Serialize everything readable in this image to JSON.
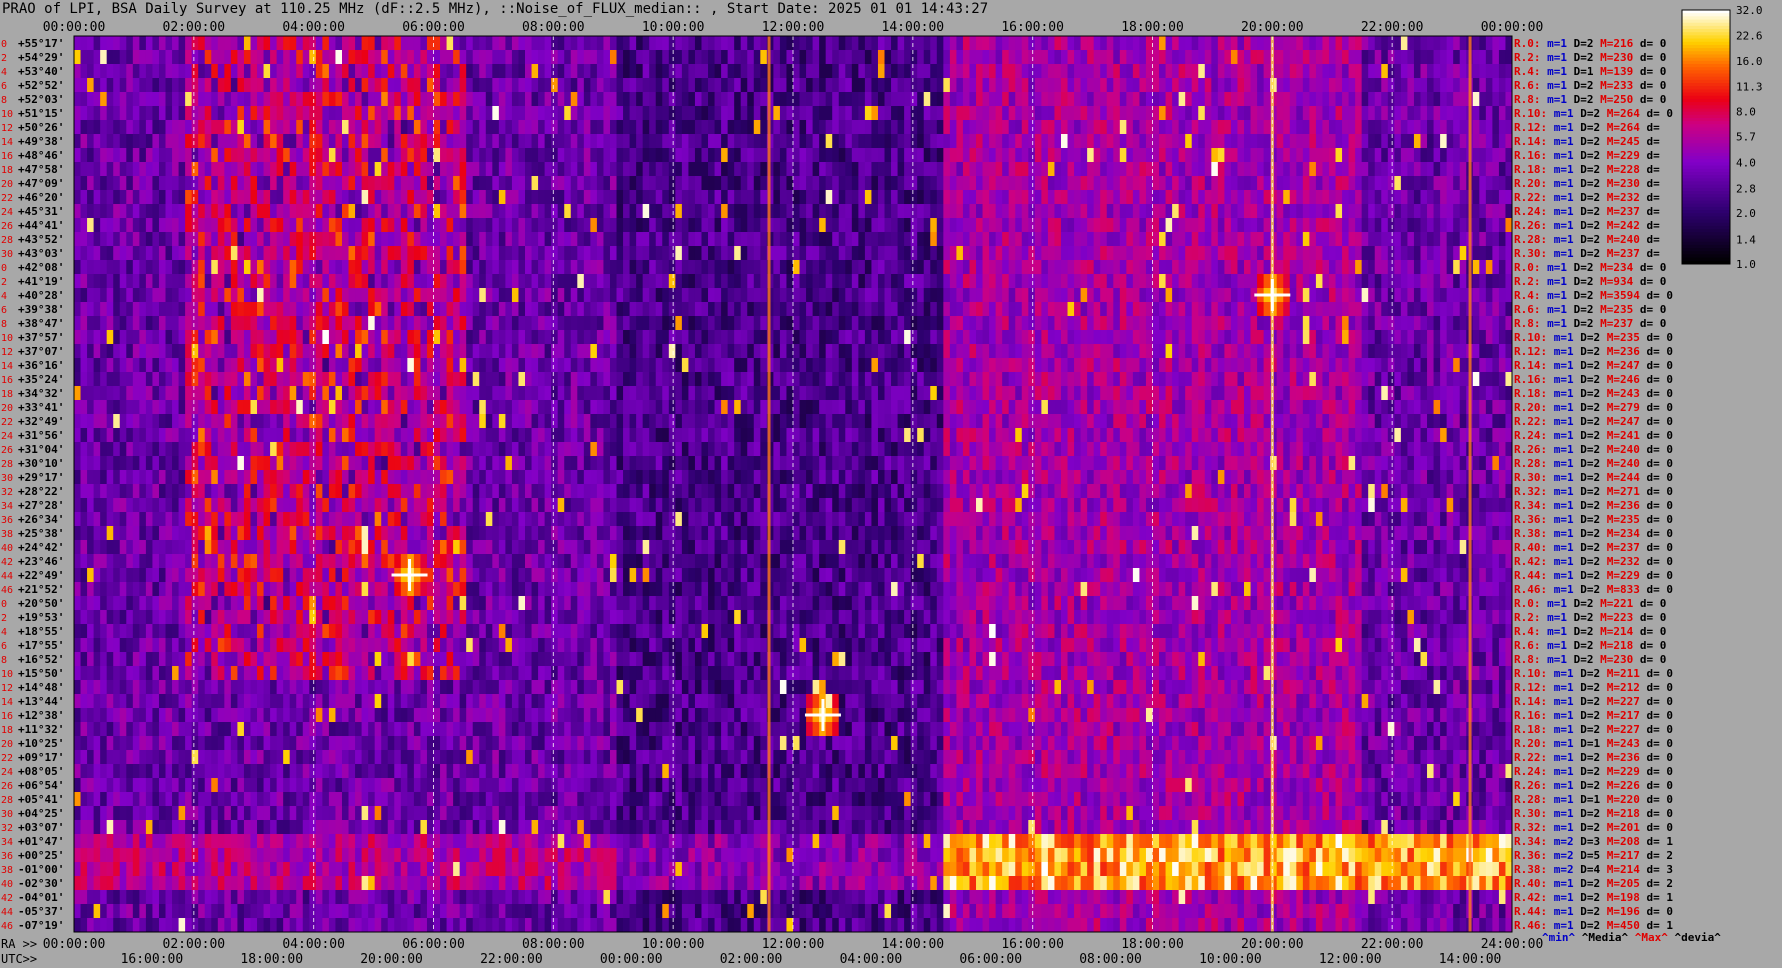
{
  "title": "PRAO of LPI, BSA Daily Survey at 110.25 MHz (dF::2.5 MHz), ::Noise_of_FLUX_median:: , Start Date: 2025 01 01 14:43:27",
  "chart_data": {
    "type": "heatmap",
    "ra_label": "RA >>",
    "utc_label": "UTC>>",
    "top_ticks": [
      "00:00:00",
      "02:00:00",
      "04:00:00",
      "06:00:00",
      "08:00:00",
      "10:00:00",
      "12:00:00",
      "14:00:00",
      "16:00:00",
      "18:00:00",
      "20:00:00",
      "22:00:00",
      "00:00:00"
    ],
    "ra_ticks": [
      "00:00:00",
      "02:00:00",
      "04:00:00",
      "06:00:00",
      "08:00:00",
      "10:00:00",
      "12:00:00",
      "14:00:00",
      "16:00:00",
      "18:00:00",
      "20:00:00",
      "22:00:00",
      "24:00:00"
    ],
    "utc_ticks": [
      "16:00:00",
      "18:00:00",
      "20:00:00",
      "22:00:00",
      "00:00:00",
      "02:00:00",
      "04:00:00",
      "06:00:00",
      "08:00:00",
      "10:00:00",
      "12:00:00",
      "14:00:00"
    ],
    "declinations": [
      "+55°17'",
      "+54°29'",
      "+53°40'",
      "+52°52'",
      "+52°03'",
      "+51°15'",
      "+50°26'",
      "+49°38'",
      "+48°46'",
      "+47°58'",
      "+47°09'",
      "+46°20'",
      "+45°31'",
      "+44°41'",
      "+43°52'",
      "+43°03'",
      "+42°08'",
      "+41°19'",
      "+40°28'",
      "+39°38'",
      "+38°47'",
      "+37°57'",
      "+37°07'",
      "+36°16'",
      "+35°24'",
      "+34°32'",
      "+33°41'",
      "+32°49'",
      "+31°56'",
      "+31°04'",
      "+30°10'",
      "+29°17'",
      "+28°22'",
      "+27°28'",
      "+26°34'",
      "+25°38'",
      "+24°42'",
      "+23°46'",
      "+22°49'",
      "+21°52'",
      "+20°50'",
      "+19°53'",
      "+18°55'",
      "+17°55'",
      "+16°52'",
      "+15°50'",
      "+14°48'",
      "+13°44'",
      "+12°38'",
      "+11°32'",
      "+10°25'",
      "+09°17'",
      "+08°05'",
      "+06°54'",
      "+05°41'",
      "+04°25'",
      "+03°07'",
      "+01°47'",
      "+00°25'",
      "-01°00'",
      "-02°30'",
      "-04°01'",
      "-05°37'",
      "-07°19'"
    ],
    "row_index_labels": [
      "0",
      "2",
      "4",
      "6",
      "8",
      "10",
      "12",
      "14",
      "16",
      "18",
      "20",
      "22",
      "24",
      "26",
      "28",
      "30",
      "0",
      "2",
      "4",
      "6",
      "8",
      "10",
      "12",
      "14",
      "16",
      "18",
      "20",
      "22",
      "24",
      "26",
      "28",
      "30",
      "32",
      "34",
      "36",
      "38",
      "40",
      "42",
      "44",
      "46",
      "0",
      "2",
      "4",
      "6",
      "8",
      "10",
      "12",
      "14",
      "16",
      "18",
      "20",
      "22",
      "24",
      "26",
      "28",
      "30",
      "32",
      "34",
      "36",
      "38",
      "40",
      "42",
      "44",
      "46"
    ],
    "stats": [
      {
        "r": "R.0:",
        "m": 1,
        "D": 2,
        "M": 216,
        "d": "0"
      },
      {
        "r": "R.2:",
        "m": 1,
        "D": 2,
        "M": 230,
        "d": "0"
      },
      {
        "r": "R.4:",
        "m": 1,
        "D": 1,
        "M": 139,
        "d": "0"
      },
      {
        "r": "R.6:",
        "m": 1,
        "D": 2,
        "M": 233,
        "d": "0"
      },
      {
        "r": "R.8:",
        "m": 1,
        "D": 2,
        "M": 250,
        "d": "0"
      },
      {
        "r": "R.10:",
        "m": 1,
        "D": 2,
        "M": 264,
        "d": "0"
      },
      {
        "r": "R.12:",
        "m": 1,
        "D": 2,
        "M": 264,
        "d": ""
      },
      {
        "r": "R.14:",
        "m": 1,
        "D": 2,
        "M": 245,
        "d": ""
      },
      {
        "r": "R.16:",
        "m": 1,
        "D": 2,
        "M": 229,
        "d": ""
      },
      {
        "r": "R.18:",
        "m": 1,
        "D": 2,
        "M": 228,
        "d": ""
      },
      {
        "r": "R.20:",
        "m": 1,
        "D": 2,
        "M": 230,
        "d": ""
      },
      {
        "r": "R.22:",
        "m": 1,
        "D": 2,
        "M": 232,
        "d": ""
      },
      {
        "r": "R.24:",
        "m": 1,
        "D": 2,
        "M": 237,
        "d": ""
      },
      {
        "r": "R.26:",
        "m": 1,
        "D": 2,
        "M": 242,
        "d": ""
      },
      {
        "r": "R.28:",
        "m": 1,
        "D": 2,
        "M": 240,
        "d": ""
      },
      {
        "r": "R.30:",
        "m": 1,
        "D": 2,
        "M": 237,
        "d": ""
      },
      {
        "r": "R.0:",
        "m": 1,
        "D": 2,
        "M": 234,
        "d": "0"
      },
      {
        "r": "R.2:",
        "m": 1,
        "D": 2,
        "M": 934,
        "d": "0"
      },
      {
        "r": "R.4:",
        "m": 1,
        "D": 2,
        "M": 3594,
        "d": "0"
      },
      {
        "r": "R.6:",
        "m": 1,
        "D": 2,
        "M": 235,
        "d": "0"
      },
      {
        "r": "R.8:",
        "m": 1,
        "D": 2,
        "M": 237,
        "d": "0"
      },
      {
        "r": "R.10:",
        "m": 1,
        "D": 2,
        "M": 235,
        "d": "0"
      },
      {
        "r": "R.12:",
        "m": 1,
        "D": 2,
        "M": 236,
        "d": "0"
      },
      {
        "r": "R.14:",
        "m": 1,
        "D": 2,
        "M": 247,
        "d": "0"
      },
      {
        "r": "R.16:",
        "m": 1,
        "D": 2,
        "M": 246,
        "d": "0"
      },
      {
        "r": "R.18:",
        "m": 1,
        "D": 2,
        "M": 243,
        "d": "0"
      },
      {
        "r": "R.20:",
        "m": 1,
        "D": 2,
        "M": 279,
        "d": "0"
      },
      {
        "r": "R.22:",
        "m": 1,
        "D": 2,
        "M": 247,
        "d": "0"
      },
      {
        "r": "R.24:",
        "m": 1,
        "D": 2,
        "M": 241,
        "d": "0"
      },
      {
        "r": "R.26:",
        "m": 1,
        "D": 2,
        "M": 240,
        "d": "0"
      },
      {
        "r": "R.28:",
        "m": 1,
        "D": 2,
        "M": 240,
        "d": "0"
      },
      {
        "r": "R.30:",
        "m": 1,
        "D": 2,
        "M": 244,
        "d": "0"
      },
      {
        "r": "R.32:",
        "m": 1,
        "D": 2,
        "M": 271,
        "d": "0"
      },
      {
        "r": "R.34:",
        "m": 1,
        "D": 2,
        "M": 236,
        "d": "0"
      },
      {
        "r": "R.36:",
        "m": 1,
        "D": 2,
        "M": 235,
        "d": "0"
      },
      {
        "r": "R.38:",
        "m": 1,
        "D": 2,
        "M": 234,
        "d": "0"
      },
      {
        "r": "R.40:",
        "m": 1,
        "D": 2,
        "M": 237,
        "d": "0"
      },
      {
        "r": "R.42:",
        "m": 1,
        "D": 2,
        "M": 232,
        "d": "0"
      },
      {
        "r": "R.44:",
        "m": 1,
        "D": 2,
        "M": 229,
        "d": "0"
      },
      {
        "r": "R.46:",
        "m": 1,
        "D": 2,
        "M": 833,
        "d": "0"
      },
      {
        "r": "R.0:",
        "m": 1,
        "D": 2,
        "M": 221,
        "d": "0"
      },
      {
        "r": "R.2:",
        "m": 1,
        "D": 2,
        "M": 223,
        "d": "0"
      },
      {
        "r": "R.4:",
        "m": 1,
        "D": 2,
        "M": 214,
        "d": "0"
      },
      {
        "r": "R.6:",
        "m": 1,
        "D": 2,
        "M": 218,
        "d": "0"
      },
      {
        "r": "R.8:",
        "m": 1,
        "D": 2,
        "M": 230,
        "d": "0"
      },
      {
        "r": "R.10:",
        "m": 1,
        "D": 2,
        "M": 211,
        "d": "0"
      },
      {
        "r": "R.12:",
        "m": 1,
        "D": 2,
        "M": 212,
        "d": "0"
      },
      {
        "r": "R.14:",
        "m": 1,
        "D": 2,
        "M": 227,
        "d": "0"
      },
      {
        "r": "R.16:",
        "m": 1,
        "D": 2,
        "M": 217,
        "d": "0"
      },
      {
        "r": "R.18:",
        "m": 1,
        "D": 2,
        "M": 227,
        "d": "0"
      },
      {
        "r": "R.20:",
        "m": 1,
        "D": 1,
        "M": 243,
        "d": "0"
      },
      {
        "r": "R.22:",
        "m": 1,
        "D": 2,
        "M": 236,
        "d": "0"
      },
      {
        "r": "R.24:",
        "m": 1,
        "D": 2,
        "M": 229,
        "d": "0"
      },
      {
        "r": "R.26:",
        "m": 1,
        "D": 2,
        "M": 226,
        "d": "0"
      },
      {
        "r": "R.28:",
        "m": 1,
        "D": 1,
        "M": 220,
        "d": "0"
      },
      {
        "r": "R.30:",
        "m": 1,
        "D": 2,
        "M": 218,
        "d": "0"
      },
      {
        "r": "R.32:",
        "m": 1,
        "D": 2,
        "M": 201,
        "d": "0"
      },
      {
        "r": "R.34:",
        "m": 2,
        "D": 3,
        "M": 208,
        "d": "1"
      },
      {
        "r": "R.36:",
        "m": 2,
        "D": 5,
        "M": 217,
        "d": "2"
      },
      {
        "r": "R.38:",
        "m": 2,
        "D": 4,
        "M": 214,
        "d": "3"
      },
      {
        "r": "R.40:",
        "m": 1,
        "D": 2,
        "M": 205,
        "d": "2"
      },
      {
        "r": "R.42:",
        "m": 1,
        "D": 2,
        "M": 198,
        "d": "1"
      },
      {
        "r": "R.44:",
        "m": 1,
        "D": 2,
        "M": 196,
        "d": "0"
      },
      {
        "r": "R.46:",
        "m": 1,
        "D": 2,
        "M": 450,
        "d": "1"
      }
    ],
    "stats_legend": {
      "min": "^min^",
      "median": "^Media^",
      "max": "^Max^",
      "devia": "^devia^"
    },
    "colorbar_ticks": [
      "32.0",
      "22.6",
      "16.0",
      "11.3",
      "8.0",
      "5.7",
      "4.0",
      "2.8",
      "2.0",
      "1.4",
      "1.0"
    ],
    "colorbar_range": [
      1.0,
      32.0
    ],
    "colorbar_scale": "log",
    "colors": {
      "bg": "#a8a8a8",
      "stat_r": "#e00000",
      "stat_m": "#0000c8",
      "stat_D": "#000000",
      "stat_M": "#e00000",
      "stat_d": "#000000"
    },
    "features": {
      "source_vertical_lines_ra_hours": [
        20.0,
        23.3,
        11.6
      ],
      "bright_sources": [
        {
          "ra_hours": 20.0,
          "dec": "+40°28'"
        },
        {
          "ra_hours": 5.6,
          "dec": "+22°49'"
        },
        {
          "ra_hours": 12.5,
          "dec": "+12°38'"
        }
      ],
      "bright_band_decs": [
        "+01°47'",
        "-02°30'"
      ]
    }
  }
}
